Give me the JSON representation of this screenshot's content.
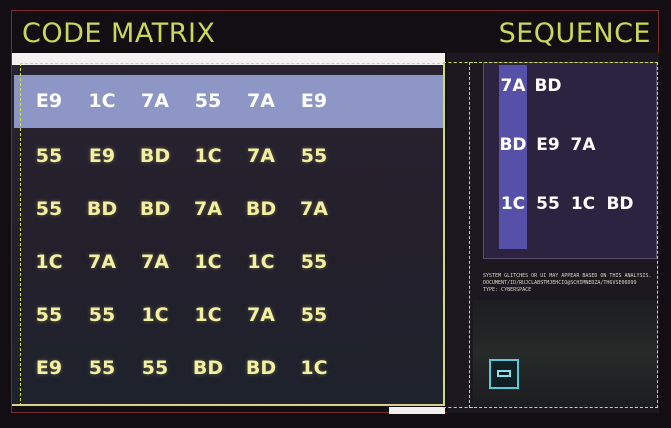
{
  "header": {
    "left_title": "CODE MATRIX",
    "right_title": "SEQUENCE"
  },
  "colors": {
    "accent": "#c9d957",
    "highlight_row": "#8d96c4",
    "cell_text": "#f3f0a2",
    "sequence_strip": "#5650a8",
    "chip_border": "#5dc7d6"
  },
  "matrix": {
    "highlighted_row": 0,
    "rows": [
      [
        "E9",
        "1C",
        "7A",
        "55",
        "7A",
        "E9"
      ],
      [
        "55",
        "E9",
        "BD",
        "1C",
        "7A",
        "55"
      ],
      [
        "55",
        "BD",
        "BD",
        "7A",
        "BD",
        "7A"
      ],
      [
        "1C",
        "7A",
        "7A",
        "1C",
        "1C",
        "55"
      ],
      [
        "55",
        "55",
        "1C",
        "1C",
        "7A",
        "55"
      ],
      [
        "E9",
        "55",
        "55",
        "BD",
        "BD",
        "1C"
      ]
    ]
  },
  "sequence": {
    "rows": [
      [
        "7A",
        "BD"
      ],
      [
        "BD",
        "E9",
        "7A"
      ],
      [
        "1C",
        "55",
        "1C",
        "BD"
      ]
    ]
  },
  "info": {
    "lines": [
      "SYSTEM GLITCHES OR UI MAY APPEAR BASED ON THIS ANALYSIS.",
      "DOCUMENT/ID/RUJCLABSTMJEHCIO@SCHIMNEDZA/TH6VSE06D99",
      "TYPE: CYBERSPACE"
    ]
  },
  "chip": {
    "icon": "breach-chip-icon"
  }
}
